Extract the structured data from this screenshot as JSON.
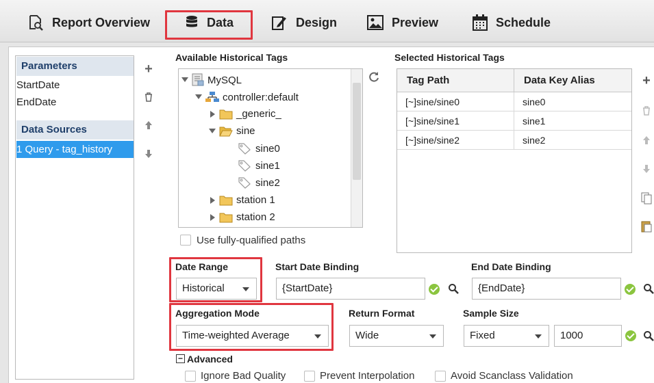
{
  "tabs": [
    {
      "label": "Report Overview",
      "icon": "report-search-icon"
    },
    {
      "label": "Data",
      "icon": "database-icon"
    },
    {
      "label": "Design",
      "icon": "design-edit-icon"
    },
    {
      "label": "Preview",
      "icon": "image-preview-icon"
    },
    {
      "label": "Schedule",
      "icon": "calendar-icon"
    }
  ],
  "active_tab": "Data",
  "sidebar": {
    "parameters_header": "Parameters",
    "parameters": [
      "StartDate",
      "EndDate"
    ],
    "data_sources_header": "Data Sources",
    "data_sources": [
      "1 Query - tag_history"
    ]
  },
  "available_tags": {
    "label": "Available Historical Tags",
    "tree": {
      "root": "MySQL",
      "provider": "controller:default",
      "folders": [
        "_generic_",
        "sine",
        "station 1",
        "station 2"
      ],
      "sine_children": [
        "sine0",
        "sine1",
        "sine2"
      ]
    },
    "fully_qualified_label": "Use fully-qualified paths"
  },
  "selected_tags": {
    "label": "Selected Historical Tags",
    "columns": [
      "Tag Path",
      "Data Key Alias"
    ],
    "rows": [
      [
        "[~]sine/sine0",
        "sine0"
      ],
      [
        "[~]sine/sine1",
        "sine1"
      ],
      [
        "[~]sine/sine2",
        "sine2"
      ]
    ]
  },
  "date_range": {
    "label": "Date Range",
    "value": "Historical"
  },
  "start_date_binding": {
    "label": "Start Date Binding",
    "value": "{StartDate}"
  },
  "end_date_binding": {
    "label": "End Date Binding",
    "value": "{EndDate}"
  },
  "aggregation_mode": {
    "label": "Aggregation Mode",
    "value": "Time-weighted Average"
  },
  "return_format": {
    "label": "Return Format",
    "value": "Wide"
  },
  "sample_size": {
    "label": "Sample Size",
    "value": "Fixed",
    "count": "1000"
  },
  "advanced": {
    "label": "Advanced",
    "toggle": "−",
    "options": [
      "Ignore Bad Quality",
      "Prevent Interpolation",
      "Avoid Scanclass Validation"
    ]
  },
  "colors": {
    "highlight": "#e0363f",
    "selection": "#2f9bec",
    "section_header": "#1f3f6a",
    "ok": "#8bc53f"
  }
}
